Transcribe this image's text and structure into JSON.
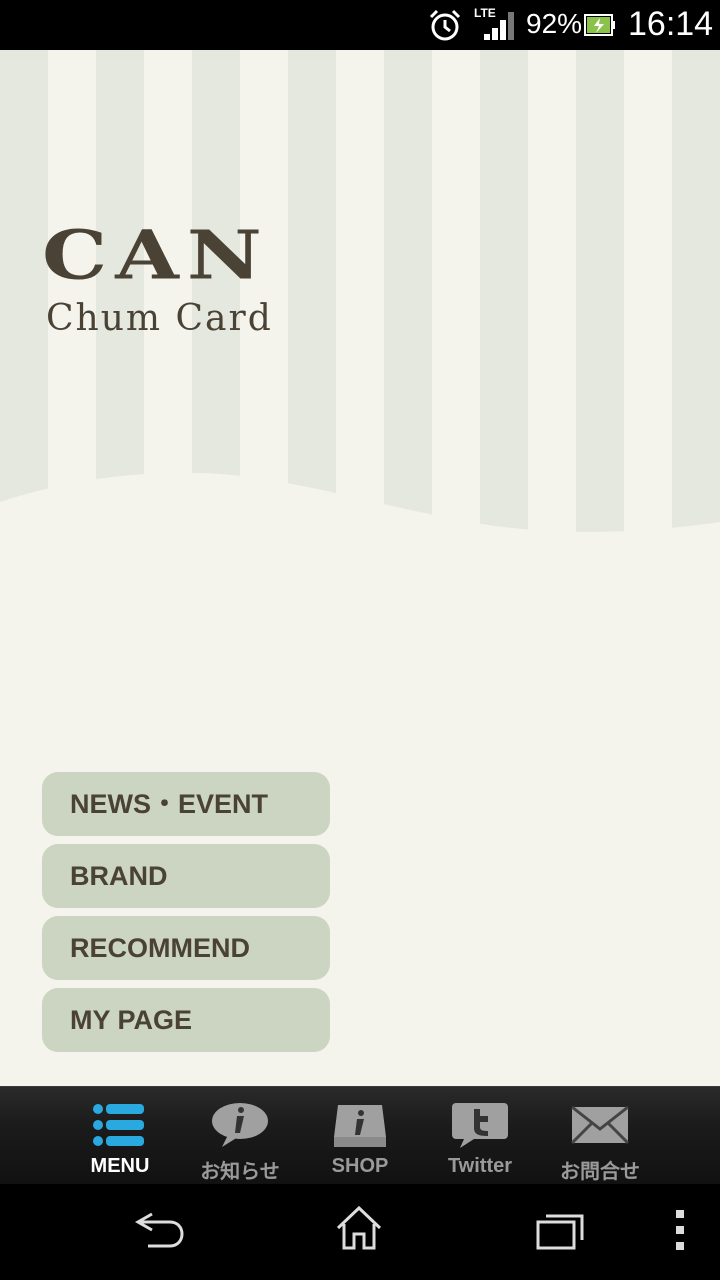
{
  "status_bar": {
    "network": "LTE",
    "battery_percent": "92%",
    "time": "16:14",
    "icons": [
      "alarm-icon",
      "signal-icon",
      "battery-icon"
    ]
  },
  "logo": {
    "title": "CAN",
    "subtitle": "Chum Card"
  },
  "menu": {
    "items": [
      {
        "label": "NEWS・EVENT"
      },
      {
        "label": "BRAND"
      },
      {
        "label": "RECOMMEND"
      },
      {
        "label": "MY PAGE"
      }
    ]
  },
  "tab_bar": {
    "tabs": [
      {
        "label": "MENU",
        "icon": "menu-list-icon",
        "active": true
      },
      {
        "label": "お知らせ",
        "icon": "info-bubble-icon",
        "active": false
      },
      {
        "label": "SHOP",
        "icon": "shop-info-icon",
        "active": false
      },
      {
        "label": "Twitter",
        "icon": "twitter-icon",
        "active": false
      },
      {
        "label": "お問合せ",
        "icon": "mail-icon",
        "active": false
      }
    ]
  },
  "colors": {
    "background": "#f4f3ec",
    "stripe": "#e5e8df",
    "logo_text": "#4a4234",
    "menu_button": "#ccd4c2",
    "tab_active_icon": "#29a9e0"
  }
}
